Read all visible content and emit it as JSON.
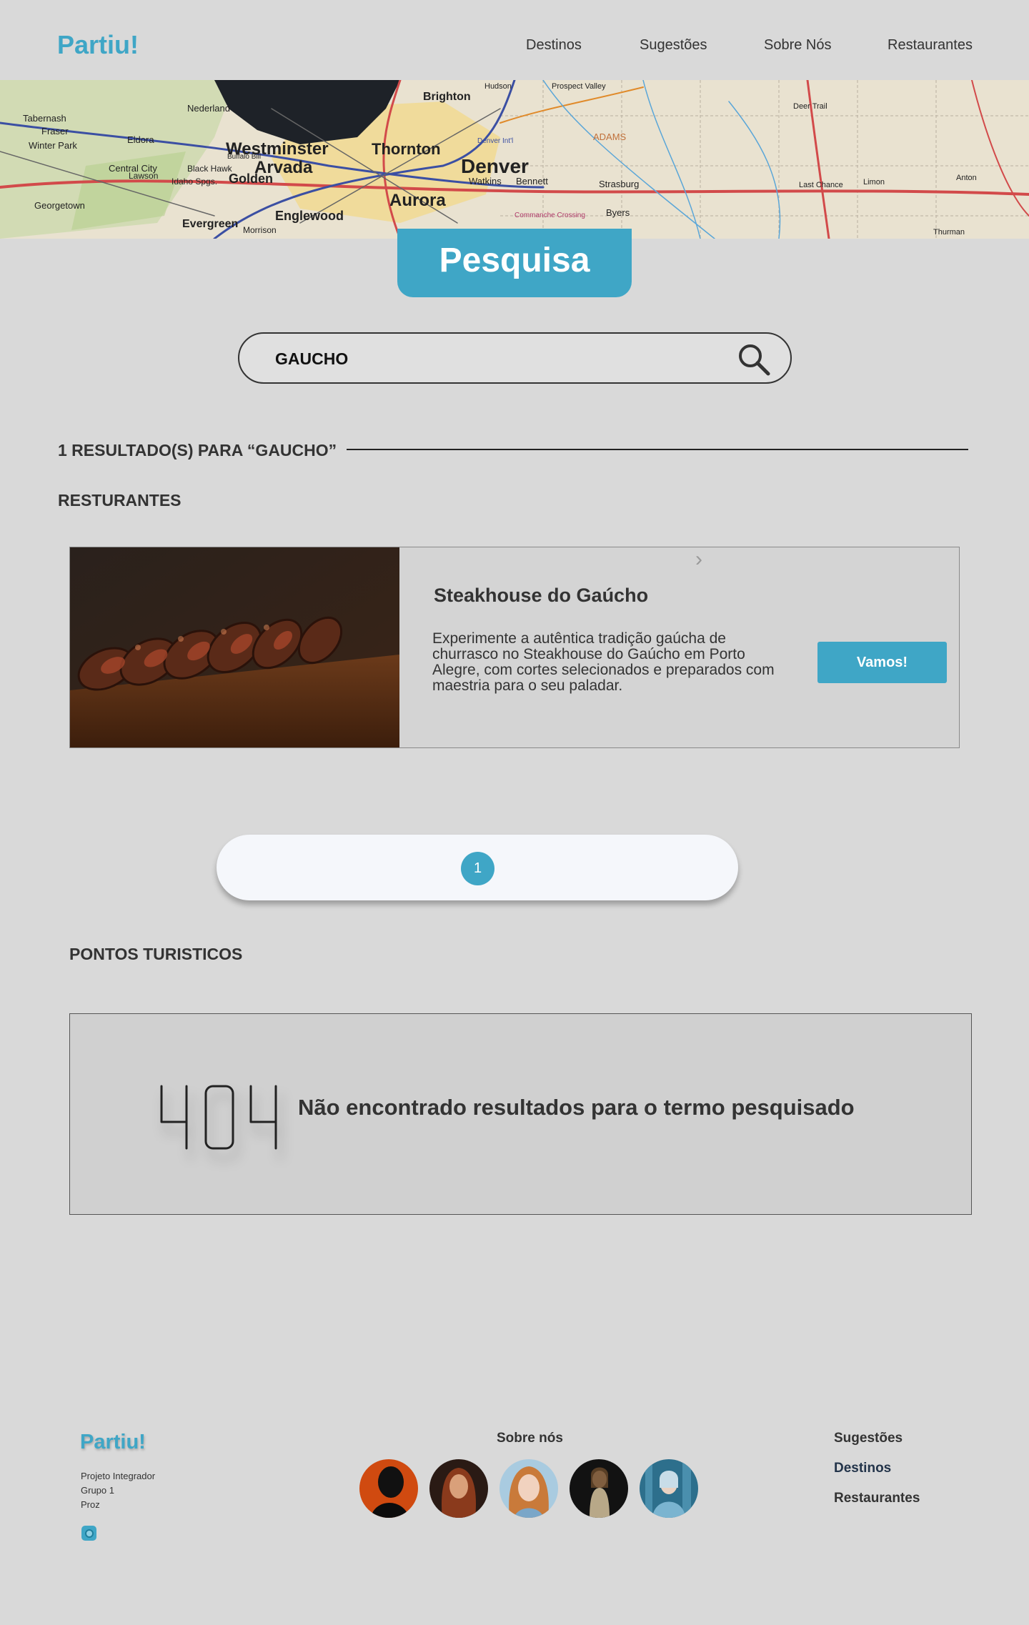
{
  "header": {
    "logo": "Partiu!",
    "nav": [
      "Destinos",
      "Sugestões",
      "Sobre Nós",
      "Restaurantes"
    ]
  },
  "banner": {
    "map_labels": [
      "Westminster",
      "Thornton",
      "Denver",
      "Arvada",
      "Aurora",
      "Golden",
      "Englewood",
      "Brighton",
      "Evergreen",
      "Strasburg",
      "Bennett",
      "Watkins",
      "ADAMS",
      "Byers",
      "Central City",
      "Eldora",
      "Nederland",
      "Georgetown",
      "Lawson",
      "Black Hawk",
      "Idaho Spgs.",
      "Fraser",
      "Winter Park",
      "Tabernash",
      "Hudson",
      "Prospect Valley",
      "Deer Trail",
      "Limon",
      "Last Chance",
      "Anton",
      "Thurman",
      "Denver Int'l",
      "Commanche Crossing",
      "Buffalo Bill",
      "Morrison"
    ]
  },
  "pesquisa_label": "Pesquisa",
  "search": {
    "value": "GAUCHO"
  },
  "results": {
    "title": "1 RESULTADO(S) PARA “GAUCHO”",
    "restaurants_heading": "RESTURANTES",
    "tourist_heading": "PONTOS TURISTICOS"
  },
  "restaurant_card": {
    "chevron": "›",
    "title": "Steakhouse do Gaúcho",
    "description": "Experimente a autêntica tradição gaúcha de churrasco no Steakhouse do Gaúcho em Porto Alegre, com cortes selecionados e preparados com maestria para o seu paladar.",
    "button": "Vamos!"
  },
  "pagination": {
    "current_page": "1"
  },
  "not_found": {
    "code": "404",
    "message": "Não encontrado resultados para o termo pesquisado"
  },
  "footer": {
    "logo": "Partiu!",
    "info": [
      "Projeto Integrador",
      "Grupo 1",
      "Proz"
    ],
    "about_title": "Sobre nós",
    "links": [
      "Sugestões",
      "Destinos",
      "Restaurantes"
    ]
  },
  "colors": {
    "accent": "#3fa6c6",
    "background": "#d9d9d9",
    "text": "#333333"
  }
}
